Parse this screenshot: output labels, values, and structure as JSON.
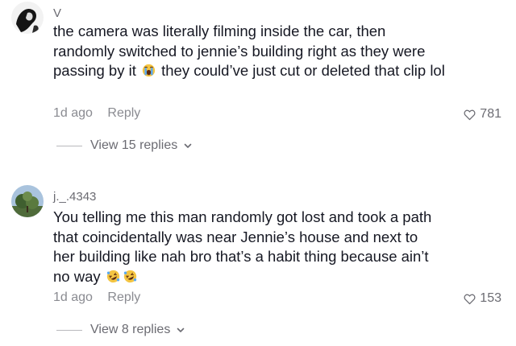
{
  "comments": [
    {
      "username": "V",
      "text_part1": "the camera was literally filming inside the car, then randomly switched to jennie’s building right as they were passing by it",
      "text_part2": " they could’ve just cut or deleted that clip lol",
      "emoji": "crying-face-emoji",
      "time": "1d ago",
      "reply_label": "Reply",
      "likes": "781",
      "view_replies": "View 15 replies"
    },
    {
      "username": "j._.4343",
      "text_part1": "You telling me this man randomly got lost and took a path that coincidentally was near Jennie’s house and next to her building like nah bro that’s a habit thing because ain’t no way",
      "emoji": "rofl-emoji",
      "time": "1d ago",
      "reply_label": "Reply",
      "likes": "153",
      "view_replies": "View 8 replies"
    }
  ],
  "colors": {
    "text": "#161823",
    "muted": "#8a8b91",
    "background": "#ffffff"
  }
}
